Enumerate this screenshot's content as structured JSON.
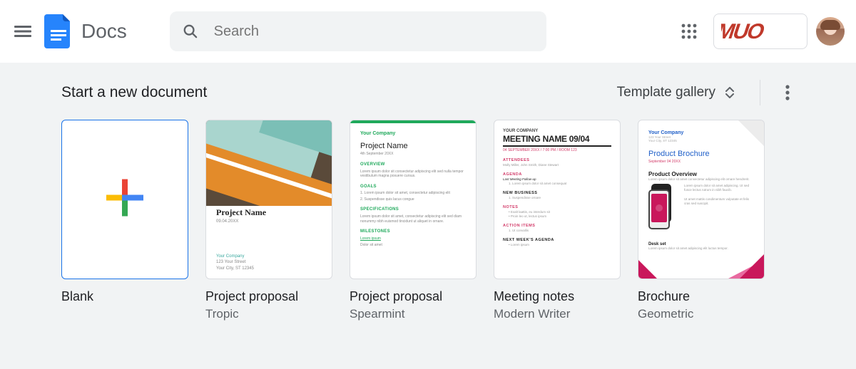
{
  "header": {
    "app_name": "Docs",
    "search_placeholder": "Search",
    "brand_pill_text": "MUO"
  },
  "templates_section": {
    "title": "Start a new document",
    "gallery_label": "Template gallery"
  },
  "templates": [
    {
      "title": "Blank",
      "subtitle": ""
    },
    {
      "title": "Project proposal",
      "subtitle": "Tropic"
    },
    {
      "title": "Project proposal",
      "subtitle": "Spearmint"
    },
    {
      "title": "Meeting notes",
      "subtitle": "Modern Writer"
    },
    {
      "title": "Brochure",
      "subtitle": "Geometric"
    }
  ],
  "thumb_text": {
    "tropic": {
      "project_name": "Project Name",
      "date": "09.04.20XX",
      "footer1": "Your Company",
      "footer2": "123 Your Street",
      "footer3": "Your City, ST 12345"
    },
    "spearmint": {
      "your_company": "Your Company",
      "project_name": "Project Name",
      "date": "4th September 20XX",
      "h1": "OVERVIEW",
      "h2": "GOALS",
      "h3": "SPECIFICATIONS",
      "h4": "MILESTONES",
      "m1": "Lorem ipsum"
    },
    "meeting": {
      "your_company": "YOUR COMPANY",
      "title": "MEETING NAME 09/04",
      "date": "04 SEPTEMBER 20XX / 7:00 PM / ROOM 123",
      "h1": "ATTENDEES",
      "h2": "AGENDA",
      "a1": "Last Meeting Follow-up",
      "h3": "NEW BUSINESS",
      "h4": "NOTES",
      "h5": "ACTION ITEMS",
      "h6": "NEXT WEEK'S AGENDA"
    },
    "brochure": {
      "your_company": "Your Company",
      "title": "Product Brochure",
      "date": "September 04 20XX",
      "sub": "Product Overview",
      "desk": "Desk set"
    }
  }
}
